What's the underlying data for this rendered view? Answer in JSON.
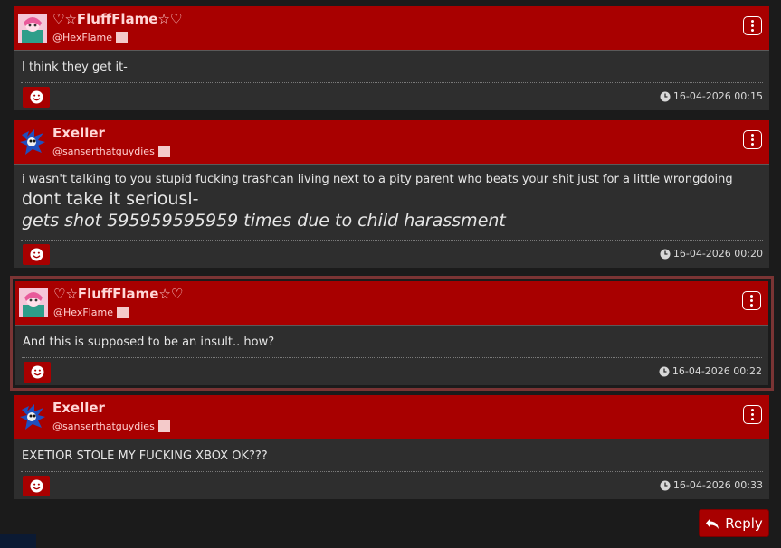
{
  "colors": {
    "accent": "#a80000",
    "post_bg": "#2e2e2e",
    "page_bg": "#1b1b1b",
    "highlight": "#7a3434"
  },
  "posts": [
    {
      "author": "♡☆FluffFlame☆♡",
      "handle": "@HexFlame",
      "avatar": "pink-character-avatar",
      "lines": [
        "I think they get it-"
      ],
      "big": "",
      "bigi": "",
      "time": "16-04-2026 00:15"
    },
    {
      "author": "Exeller",
      "handle": "@sanserthatguydies",
      "avatar": "blue-hedgehog-avatar",
      "lines": [
        "i wasn't talking to you stupid fucking trashcan living next to a pity parent who beats your shit just for a little wrongdoing"
      ],
      "big": "dont take it seriousl-",
      "bigi": "gets shot 595959595959 times due to child harassment",
      "time": "16-04-2026 00:20"
    },
    {
      "author": "♡☆FluffFlame☆♡",
      "handle": "@HexFlame",
      "avatar": "pink-character-avatar",
      "lines": [
        "And this is supposed to be an insult.. how?"
      ],
      "big": "",
      "bigi": "",
      "time": "16-04-2026 00:22"
    },
    {
      "author": "Exeller",
      "handle": "@sanserthatguydies",
      "avatar": "blue-hedgehog-avatar",
      "lines": [
        "EXETIOR STOLE MY FUCKING XBOX OK???"
      ],
      "big": "",
      "bigi": "",
      "time": "16-04-2026 00:33"
    }
  ],
  "reply": {
    "label": "Reply",
    "icon": "reply-arrow-icon"
  }
}
